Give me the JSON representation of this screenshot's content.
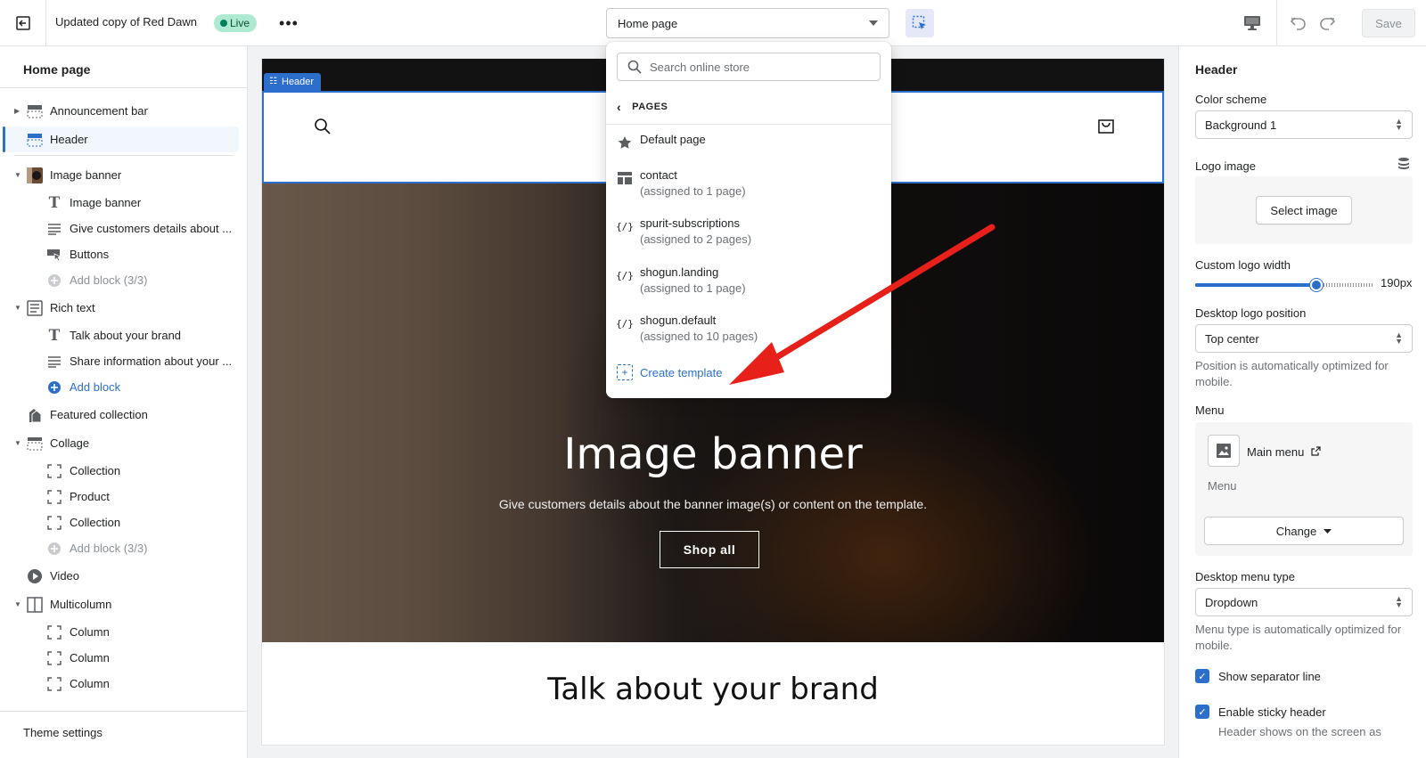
{
  "topbar": {
    "theme_name": "Updated copy of Red Dawn",
    "live_label": "Live",
    "more_label": "•••",
    "page_select": "Home page",
    "save_label": "Save"
  },
  "left": {
    "title": "Home page",
    "items": [
      {
        "label": "Announcement bar"
      },
      {
        "label": "Header"
      },
      {
        "label": "Image banner"
      },
      {
        "label": "Image banner"
      },
      {
        "label": "Give customers details about ..."
      },
      {
        "label": "Buttons"
      },
      {
        "label": "Add block (3/3)"
      },
      {
        "label": "Rich text"
      },
      {
        "label": "Talk about your brand"
      },
      {
        "label": "Share information about your ..."
      },
      {
        "label": "Add block"
      },
      {
        "label": "Featured collection"
      },
      {
        "label": "Collage"
      },
      {
        "label": "Collection"
      },
      {
        "label": "Product"
      },
      {
        "label": "Collection"
      },
      {
        "label": "Add block (3/3)"
      },
      {
        "label": "Video"
      },
      {
        "label": "Multicolumn"
      },
      {
        "label": "Column"
      },
      {
        "label": "Column"
      },
      {
        "label": "Column"
      }
    ],
    "theme_settings": "Theme settings"
  },
  "preview": {
    "header_tag": "Header",
    "banner_title": "Image banner",
    "banner_text": "Give customers details about the banner image(s) or content on the template.",
    "banner_button": "Shop all",
    "rich_title": "Talk about your brand"
  },
  "dropdown": {
    "search_placeholder": "Search online store",
    "section_label": "PAGES",
    "items": [
      {
        "name": "Default page",
        "sub": ""
      },
      {
        "name": "contact",
        "sub": "(assigned to 1 page)"
      },
      {
        "name": "spurit-subscriptions",
        "sub": "(assigned to 2 pages)"
      },
      {
        "name": "shogun.landing",
        "sub": "(assigned to 1 page)"
      },
      {
        "name": "shogun.default",
        "sub": "(assigned to 10 pages)"
      }
    ],
    "liquid_glyph": "{/}",
    "create_label": "Create template"
  },
  "right": {
    "title": "Header",
    "color_scheme_label": "Color scheme",
    "color_scheme_value": "Background 1",
    "logo_image_label": "Logo image",
    "select_image_label": "Select image",
    "logo_width_label": "Custom logo width",
    "logo_width_value": "190px",
    "logo_width_fraction": 0.68,
    "logo_position_label": "Desktop logo position",
    "logo_position_value": "Top center",
    "logo_position_help": "Position is automatically optimized for mobile.",
    "menu_label": "Menu",
    "menu_name": "Main menu",
    "menu_sub": "Menu",
    "change_label": "Change",
    "menu_type_label": "Desktop menu type",
    "menu_type_value": "Dropdown",
    "menu_type_help": "Menu type is automatically optimized for mobile.",
    "separator_label": "Show separator line",
    "sticky_label": "Enable sticky header",
    "sticky_help": "Header shows on the screen as"
  },
  "colors": {
    "accent": "#2c6ecb",
    "live": "#aee9d1",
    "arrow": "#e8201a"
  }
}
